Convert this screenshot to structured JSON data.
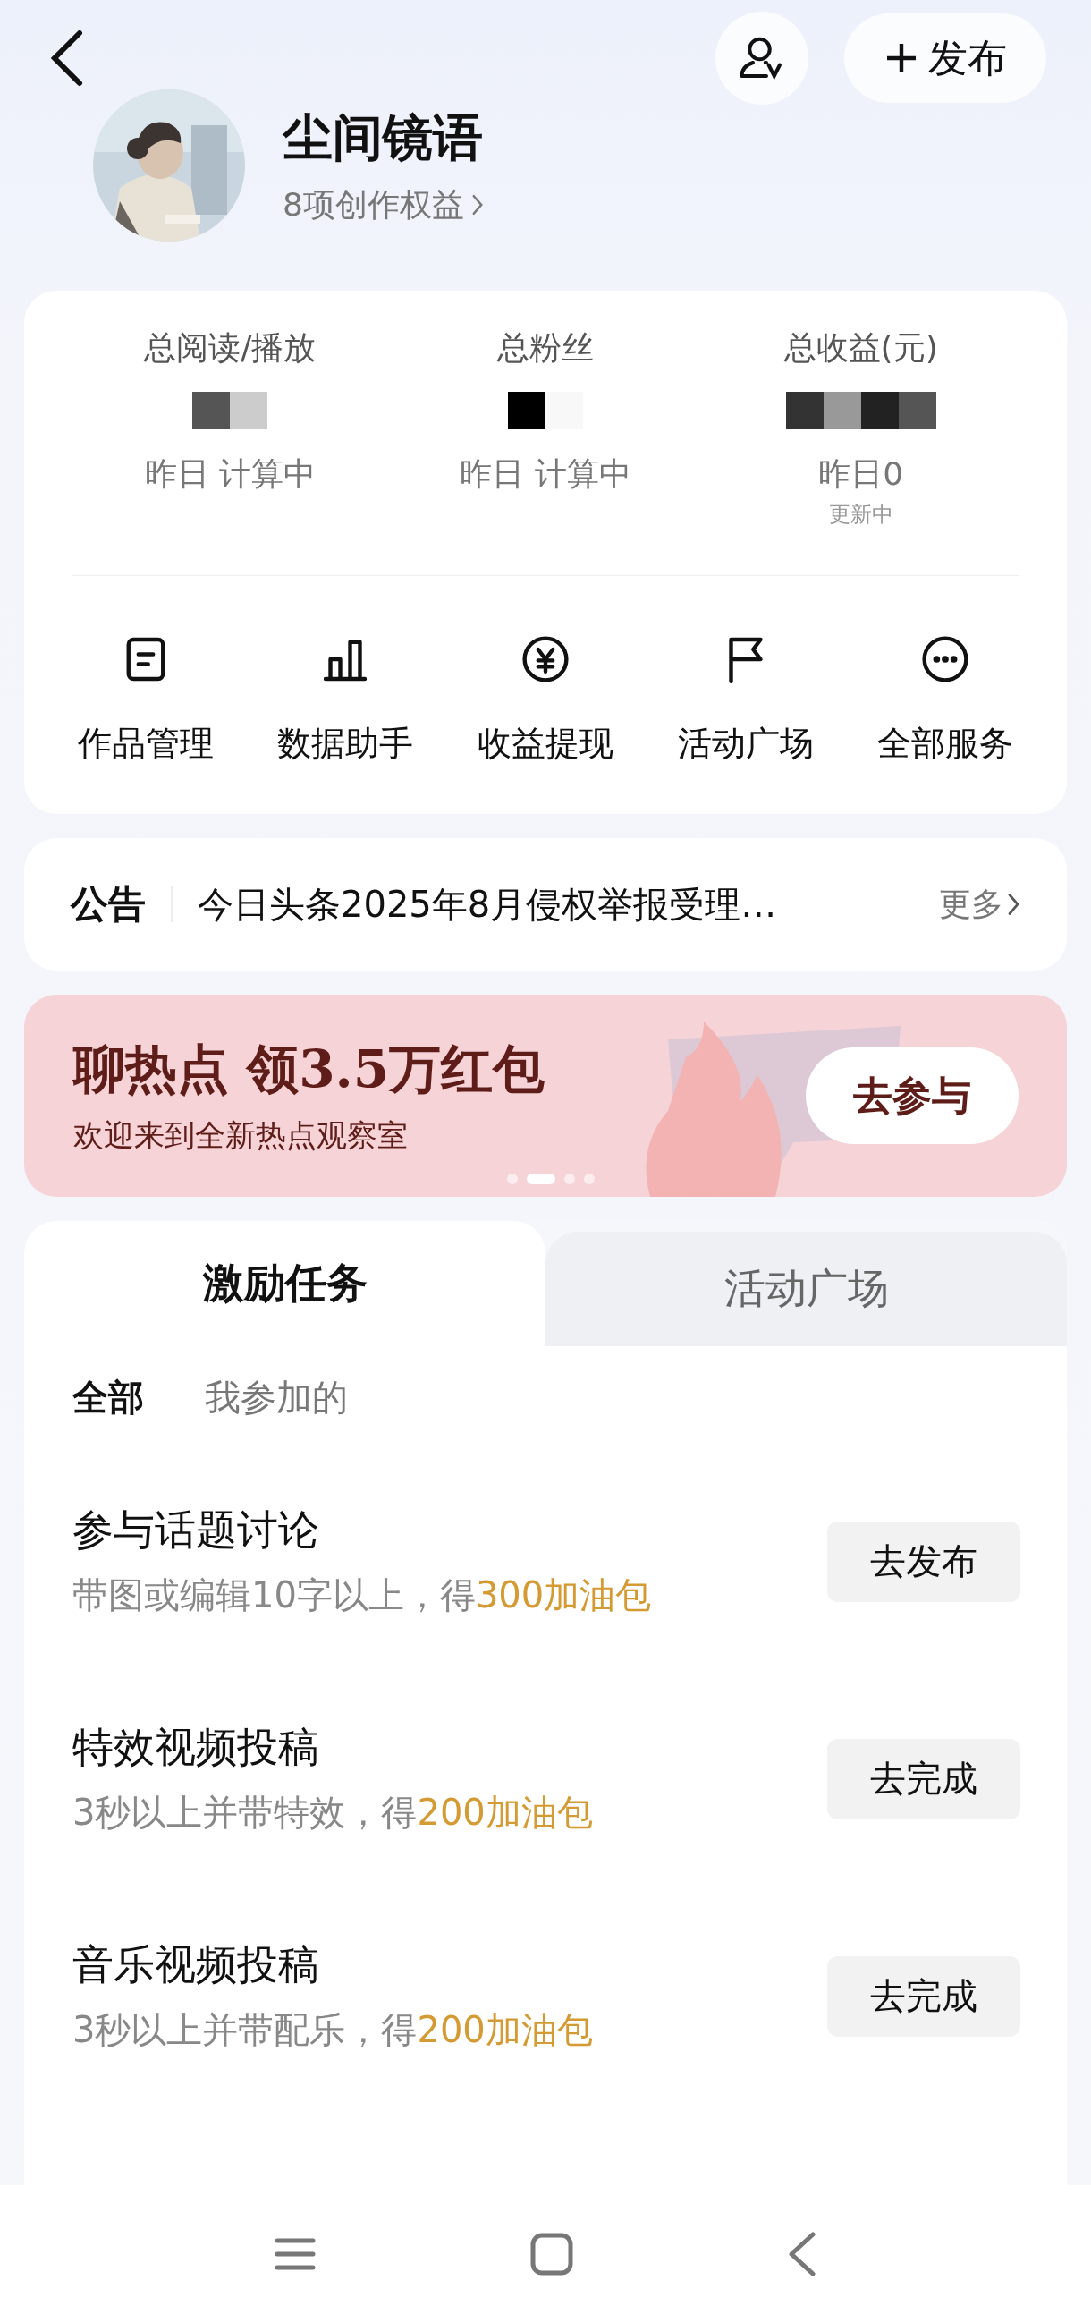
{
  "header": {
    "publish_label": "发布"
  },
  "profile": {
    "name": "尘间镜语",
    "benefits": "8项创作权益"
  },
  "stats": [
    {
      "label": "总阅读/播放",
      "yesterday": "昨日 计算中"
    },
    {
      "label": "总粉丝",
      "yesterday": "昨日 计算中"
    },
    {
      "label": "总收益(元)",
      "yesterday": "昨日0",
      "note": "更新中"
    }
  ],
  "services": [
    {
      "kind": "doc",
      "label": "作品管理"
    },
    {
      "kind": "chart",
      "label": "数据助手"
    },
    {
      "kind": "yuan",
      "label": "收益提现"
    },
    {
      "kind": "flag",
      "label": "活动广场"
    },
    {
      "kind": "more",
      "label": "全部服务"
    }
  ],
  "notice": {
    "tag": "公告",
    "text": "今日头条2025年8月侵权举报受理…",
    "more": "更多"
  },
  "banner": {
    "title": "聊热点 领3.5万红包",
    "subtitle": "欢迎来到全新热点观察室",
    "button": "去参与",
    "dots": [
      {
        "selected": false
      },
      {
        "selected": true
      },
      {
        "selected": false
      },
      {
        "selected": false
      }
    ]
  },
  "tabs": [
    {
      "label": "激励任务",
      "selected": true
    },
    {
      "label": "活动广场",
      "selected": false
    }
  ],
  "filters": [
    {
      "label": "全部",
      "selected": true
    },
    {
      "label": "我参加的",
      "selected": false
    }
  ],
  "tasks": [
    {
      "title": "参与话题讨论",
      "desc": "带图或编辑10字以上，得",
      "reward": "300加油包",
      "button": "去发布"
    },
    {
      "title": "特效视频投稿",
      "desc": "3秒以上并带特效，得",
      "reward": "200加油包",
      "button": "去完成"
    },
    {
      "title": "音乐视频投稿",
      "desc": "3秒以上并带配乐，得",
      "reward": "200加油包",
      "button": "去完成"
    }
  ]
}
